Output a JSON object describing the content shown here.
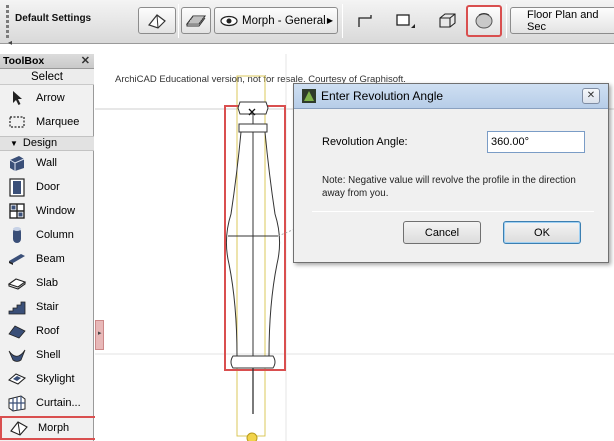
{
  "toolbar": {
    "settings_label": "Default Settings",
    "morph_dropdown_label": "Morph - General",
    "floor_plan_label": "Floor Plan and Sec",
    "scroll_left": "◂"
  },
  "toolbox": {
    "title": "ToolBox",
    "close": "✕",
    "select_header": "Select",
    "group_label": "Design",
    "tools_top": [
      {
        "id": "arrow",
        "label": "Arrow",
        "icon": "arrow-icon"
      },
      {
        "id": "marquee",
        "label": "Marquee",
        "icon": "marquee-icon"
      }
    ],
    "tools": [
      {
        "id": "wall",
        "label": "Wall",
        "icon": "wall-icon"
      },
      {
        "id": "door",
        "label": "Door",
        "icon": "door-icon"
      },
      {
        "id": "window",
        "label": "Window",
        "icon": "window-icon"
      },
      {
        "id": "column",
        "label": "Column",
        "icon": "column-icon"
      },
      {
        "id": "beam",
        "label": "Beam",
        "icon": "beam-icon"
      },
      {
        "id": "slab",
        "label": "Slab",
        "icon": "slab-icon"
      },
      {
        "id": "stair",
        "label": "Stair",
        "icon": "stair-icon"
      },
      {
        "id": "roof",
        "label": "Roof",
        "icon": "roof-icon"
      },
      {
        "id": "shell",
        "label": "Shell",
        "icon": "shell-icon"
      },
      {
        "id": "skylight",
        "label": "Skylight",
        "icon": "skylight-icon"
      },
      {
        "id": "curtain",
        "label": "Curtain...",
        "icon": "curtain-wall-icon"
      },
      {
        "id": "morph",
        "label": "Morph",
        "icon": "morph-icon"
      }
    ]
  },
  "canvas": {
    "note": "ArchiCAD Educational version, not for resale. Courtesy of Graphisoft.",
    "handle": "▸"
  },
  "dialog": {
    "title": "Enter Revolution Angle",
    "close": "✕",
    "angle_label": "Revolution Angle:",
    "angle_value": "360.00°",
    "note": "Note: Negative value will revolve the profile in the direction away from you.",
    "cancel_label": "Cancel",
    "ok_label": "OK"
  },
  "colors": {
    "highlight": "#d94f4f",
    "dialog_title_bg": "#c3d6ee",
    "ok_border": "#3c7fb1"
  }
}
